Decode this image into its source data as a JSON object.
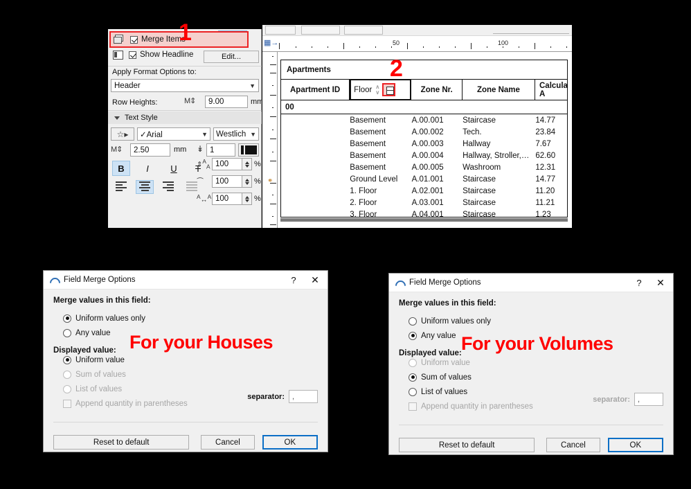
{
  "settings_panel": {
    "merge_items": {
      "label": "Merge Items",
      "checked": true,
      "icon": "merge-stack-icon"
    },
    "show_headline": {
      "label": "Show Headline",
      "checked": true,
      "icon": "headline-icon"
    },
    "edit_button": "Edit...",
    "apply_format_label": "Apply Format Options to:",
    "format_target": "Header",
    "row_heights_label": "Row Heights:",
    "row_height_value": "9.00",
    "row_height_unit": "mm",
    "text_style_section": "Text Style",
    "font": "✓Arial",
    "script": "Westlich",
    "text_size": "2.50",
    "text_size_unit": "mm",
    "pen_number": "1",
    "bold": "B",
    "italic": "I",
    "underline": "U",
    "strike": "T",
    "line_spacing": "100",
    "width_factor": "100",
    "char_spacing": "100",
    "percent": "%"
  },
  "schedule": {
    "ruler": {
      "h_marks": [
        "50",
        "100"
      ],
      "corner_icon": "insert-row-icon"
    },
    "title": "Apartments",
    "group_row": "00",
    "columns": [
      {
        "key": "apartment_id",
        "label": "Apartment ID"
      },
      {
        "key": "floor",
        "label": "Floor"
      },
      {
        "key": "zone_nr",
        "label": "Zone Nr."
      },
      {
        "key": "zone_name",
        "label": "Zone Name"
      },
      {
        "key": "calculated_area",
        "label": "Calculated A"
      }
    ],
    "floor_header_controls": {
      "spinner_up": "∧",
      "spinner_down": "∨",
      "merge_icon": "merge-cells-icon"
    },
    "rows": [
      {
        "apartment_id": "",
        "floor": "Basement",
        "zone_nr": "A.00.001",
        "zone_name": "Staircase",
        "calculated_area": "14.77"
      },
      {
        "apartment_id": "",
        "floor": "Basement",
        "zone_nr": "A.00.002",
        "zone_name": "Tech.",
        "calculated_area": "23.84"
      },
      {
        "apartment_id": "",
        "floor": "Basement",
        "zone_nr": "A.00.003",
        "zone_name": "Hallway",
        "calculated_area": "7.67"
      },
      {
        "apartment_id": "",
        "floor": "Basement",
        "zone_nr": "A.00.004",
        "zone_name": "Hallway, Stroller,…",
        "calculated_area": "62.60"
      },
      {
        "apartment_id": "",
        "floor": "Basement",
        "zone_nr": "A.00.005",
        "zone_name": "Washroom",
        "calculated_area": "12.31"
      },
      {
        "apartment_id": "",
        "floor": "Ground Level",
        "zone_nr": "A.01.001",
        "zone_name": "Staircase",
        "calculated_area": "14.77"
      },
      {
        "apartment_id": "",
        "floor": "1. Floor",
        "zone_nr": "A.02.001",
        "zone_name": "Staircase",
        "calculated_area": "11.20"
      },
      {
        "apartment_id": "",
        "floor": "2. Floor",
        "zone_nr": "A.03.001",
        "zone_name": "Staircase",
        "calculated_area": "11.21"
      },
      {
        "apartment_id": "",
        "floor": "3. Floor",
        "zone_nr": "A.04.001",
        "zone_name": "Staircase",
        "calculated_area": "1.23"
      }
    ]
  },
  "callouts": {
    "one": "1",
    "two": "2"
  },
  "dialog_left": {
    "title": "Field Merge Options",
    "help": "?",
    "close": "✕",
    "merge_section_label": "Merge values in this field:",
    "merge_options": [
      {
        "label": "Uniform values only",
        "selected": true,
        "disabled": false
      },
      {
        "label": "Any value",
        "selected": false,
        "disabled": false
      }
    ],
    "displayed_section_label": "Displayed value:",
    "displayed_options": [
      {
        "label": "Uniform value",
        "selected": true,
        "disabled": false
      },
      {
        "label": "Sum of values",
        "selected": false,
        "disabled": true
      },
      {
        "label": "List of values",
        "selected": false,
        "disabled": true
      }
    ],
    "append_quantity": {
      "label": "Append quantity in parentheses",
      "checked": false,
      "disabled": true
    },
    "separator_label": "separator:",
    "separator_value": ",",
    "buttons": {
      "reset": "Reset to default",
      "cancel": "Cancel",
      "ok": "OK"
    },
    "overlay": "For your Houses",
    "overlay_color": "#ff0000"
  },
  "dialog_right": {
    "title": "Field Merge Options",
    "help": "?",
    "close": "✕",
    "merge_section_label": "Merge values in this field:",
    "merge_options": [
      {
        "label": "Uniform values only",
        "selected": false,
        "disabled": false
      },
      {
        "label": "Any value",
        "selected": true,
        "disabled": false
      }
    ],
    "displayed_section_label": "Displayed value:",
    "displayed_options": [
      {
        "label": "Uniform value",
        "selected": false,
        "disabled": true
      },
      {
        "label": "Sum of values",
        "selected": true,
        "disabled": false
      },
      {
        "label": "List of values",
        "selected": false,
        "disabled": false
      }
    ],
    "append_quantity": {
      "label": "Append quantity in parentheses",
      "checked": false,
      "disabled": true
    },
    "separator_label": "separator:",
    "separator_value": ",",
    "buttons": {
      "reset": "Reset to default",
      "cancel": "Cancel",
      "ok": "OK"
    },
    "overlay": "For your Volumes",
    "overlay_color": "#ff0000"
  },
  "colors": {
    "highlight_border": "#ec2224",
    "highlight_fill": "#f5d0cd",
    "selection_blue": "#cde2f5",
    "dialog_bg": "#f0f0f0",
    "primary_border": "#0c6fc6"
  }
}
